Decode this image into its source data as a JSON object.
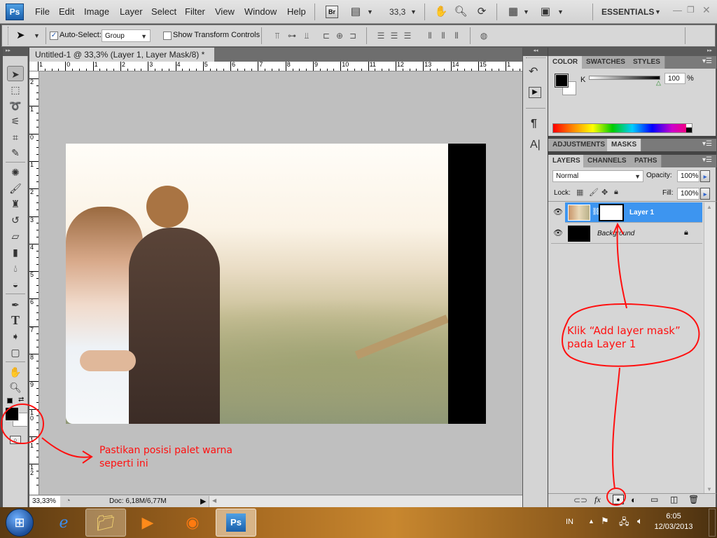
{
  "app": {
    "logo": "Ps"
  },
  "menu": {
    "items": [
      "File",
      "Edit",
      "Image",
      "Layer",
      "Select",
      "Filter",
      "View",
      "Window",
      "Help"
    ],
    "bridge_label": "Br",
    "zoom_value": "33,3",
    "workspace": "ESSENTIALS",
    "window_controls": [
      "minimize-icon",
      "restore-icon",
      "close-icon"
    ]
  },
  "options": {
    "auto_select_label": "Auto-Select:",
    "auto_select_checked": true,
    "auto_select_value": "Group",
    "show_transform_label": "Show Transform Controls",
    "show_transform_checked": false
  },
  "document": {
    "tab_title": "Untitled-1 @ 33,3% (Layer 1, Layer Mask/8) *",
    "close_glyph": "×",
    "hruler_labels": [
      "1",
      "0",
      "1",
      "2",
      "3",
      "4",
      "5",
      "6",
      "7",
      "8",
      "9",
      "10",
      "11",
      "12",
      "13",
      "14",
      "15",
      "1"
    ],
    "vruler_labels": [
      "2",
      "1",
      "0",
      "1",
      "2",
      "3",
      "4",
      "5",
      "6",
      "7",
      "8",
      "9",
      "1 0",
      "1 1",
      "1 2"
    ],
    "status_zoom": "33,33%",
    "status_doc": "Doc: 6,18M/6,77M"
  },
  "tools": [
    "move-tool",
    "marquee-tool",
    "lasso-tool",
    "magic-wand-tool",
    "crop-tool",
    "eyedropper-tool",
    "healing-brush-tool",
    "brush-tool",
    "clone-stamp-tool",
    "history-brush-tool",
    "eraser-tool",
    "gradient-tool",
    "blur-tool",
    "dodge-tool",
    "pen-tool",
    "type-tool",
    "path-selection-tool",
    "shape-tool",
    "hand-tool",
    "zoom-tool"
  ],
  "colors": {
    "foreground": "#000000",
    "background": "#ffffff",
    "layer_selected": "#3d95f0",
    "annotation": "#ff1010"
  },
  "color_panel": {
    "tabs": [
      "COLOR",
      "SWATCHES",
      "STYLES"
    ],
    "active_tab": "COLOR",
    "channel_label": "K",
    "k_value": "100",
    "k_percent": 100,
    "percent_sign": "%"
  },
  "adjust_panel": {
    "tabs": [
      "ADJUSTMENTS",
      "MASKS"
    ],
    "active_tab": "MASKS"
  },
  "layers_panel": {
    "tabs": [
      "LAYERS",
      "CHANNELS",
      "PATHS"
    ],
    "active_tab": "LAYERS",
    "blend_mode": "Normal",
    "opacity_label": "Opacity:",
    "opacity": "100%",
    "lock_label": "Lock:",
    "fill_label": "Fill:",
    "fill": "100%",
    "layers": [
      {
        "name": "Layer 1",
        "selected": true,
        "has_mask": true,
        "visible": true
      },
      {
        "name": "Background",
        "selected": false,
        "locked": true,
        "visible": true
      }
    ],
    "footer_icons": [
      "link-layers-icon",
      "fx-icon",
      "add-layer-mask-icon",
      "adjustment-layer-icon",
      "new-group-icon",
      "new-layer-icon",
      "delete-layer-icon"
    ]
  },
  "annotations": {
    "palette_note_line1": "Pastikan posisi palet warna",
    "palette_note_line2": "seperti ini",
    "mask_note_line1": "Klik “Add layer mask”",
    "mask_note_line2": "pada Layer 1"
  },
  "taskbar": {
    "apps": [
      "start-button",
      "internet-explorer",
      "windows-explorer",
      "media-player",
      "firefox",
      "photoshop"
    ],
    "language": "IN",
    "time": "6:05",
    "date": "12/03/2013"
  }
}
